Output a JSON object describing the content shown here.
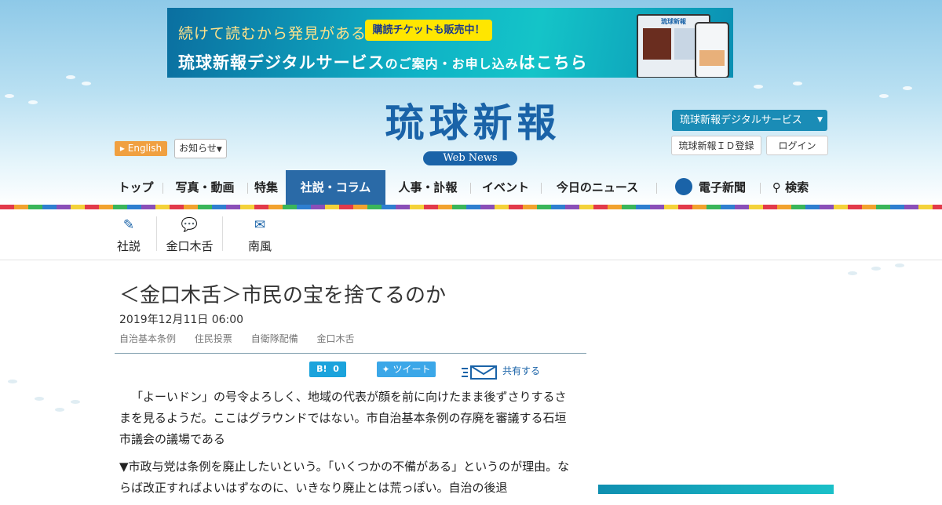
{
  "banner": {
    "line1": "続けて読むから発見がある",
    "ticket": "購読チケットも販売中！",
    "line2_a": "琉球新報デジタルサービス",
    "line2_b": "のご案内・お申し込み",
    "line2_c": "はこちら",
    "laptop_title": "琉球新報"
  },
  "header": {
    "english": "English",
    "notice": "お知らせ",
    "logo": "琉球新報",
    "webnews": "Web News",
    "digital_service": "琉球新報デジタルサービス",
    "id_register": "琉球新報ＩＤ登録",
    "login": "ログイン"
  },
  "nav": {
    "items": [
      "トップ",
      "写真・動画",
      "特集",
      "社説・コラム",
      "人事・訃報",
      "イベント",
      "今日のニュース",
      "電子新聞",
      "検索"
    ]
  },
  "subnav": {
    "items": [
      "社説",
      "金口木舌",
      "南風"
    ]
  },
  "article": {
    "title": "＜金口木舌＞市民の宝を捨てるのか",
    "date": "2019年12月11日 06:00",
    "tags": [
      "自治基本条例",
      "住民投票",
      "自衛隊配備",
      "金口木舌"
    ],
    "hatena_count": "0",
    "tweet": "ツイート",
    "share": "共有する",
    "paragraphs": [
      "「よーいドン」の号令よろしく、地域の代表が顔を前に向けたまま後ずさりするさまを見るようだ。ここはグラウンドではない。市自治基本条例の存廃を審議する石垣市議会の議場である",
      "▼市政与党は条例を廃止したいという。「いくつかの不備がある」というのが理由。ならば改正すればよいはずなのに、いきなり廃止とは荒っぽい。自治の後退"
    ]
  },
  "colors": {
    "brand": "#1a63a8",
    "nav_active": "#2a6aa7",
    "english_badge": "#f0a040",
    "ticket": "#ffe600"
  }
}
